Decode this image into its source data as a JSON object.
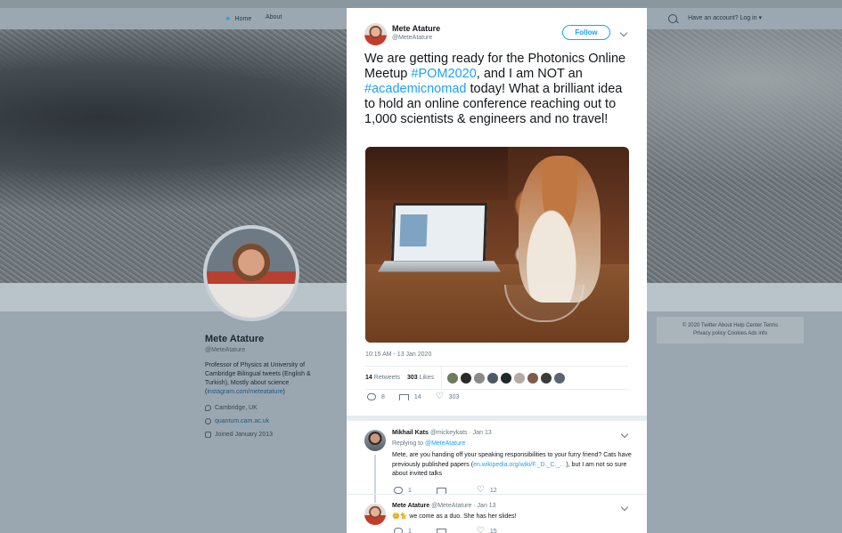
{
  "nav": {
    "home": "Home",
    "about": "About",
    "account": "Have an account? Log in ▾"
  },
  "profile": {
    "name": "Mete Atature",
    "handle": "@MeteAtature",
    "bio_prefix": "Professor of Physics at University of Cambridge Bilingual tweets (English & Turkish), Mostly about science (",
    "bio_link": "instagram.com/meteatature",
    "bio_suffix": ")",
    "location": "Cambridge, UK",
    "website": "quantum.cam.ac.uk",
    "joined": "Joined January 2013"
  },
  "footer": {
    "line1": "© 2020 Twitter   About   Help Center   Terms",
    "line2": "Privacy policy   Cookies   Ads info"
  },
  "tweet": {
    "author": "Mete Atature",
    "handle": "@MeteAtature",
    "follow_label": "Follow",
    "text_1": "We are getting ready for the Photonics Online Meetup ",
    "hashtag_1": "#POM2020",
    "text_2": ", and I am NOT an ",
    "hashtag_2": "#academicnomad",
    "text_3": " today!  What a brilliant idea to hold an online conference reaching out to 1,000 scientists & engineers and no travel!",
    "timestamp": "10:15 AM - 13 Jan 2020",
    "retweets_count": "14",
    "retweets_label": "Retweets",
    "likes_count": "303",
    "likes_label": "Likes",
    "reply_count": "8",
    "retweet_count": "14",
    "like_count": "303"
  },
  "replies": [
    {
      "name": "Mikhail Kats",
      "handle": "@mickeykats · Jan 13",
      "replying_label": "Replying to ",
      "replying_handle": "@MeteAtature",
      "text_1": "Mete, are you handing off your speaking responsibilities to your furry friend? Cats have previously published papers (",
      "link": "en.wikipedia.org/wiki/F._D._C._…",
      "text_2": "), but I am not so sure about invited talks",
      "reply_count": "1",
      "retweet_count": "",
      "like_count": "12"
    },
    {
      "name": "Mete Atature",
      "handle": "@MeteAtature · Jan 13",
      "text_1": "😊🐈 we come as a duo. She has her slides!",
      "reply_count": "1",
      "retweet_count": "",
      "like_count": "15"
    }
  ],
  "colors": {
    "accent": "#1da1f2",
    "text": "#14171a",
    "muted": "#657786"
  }
}
